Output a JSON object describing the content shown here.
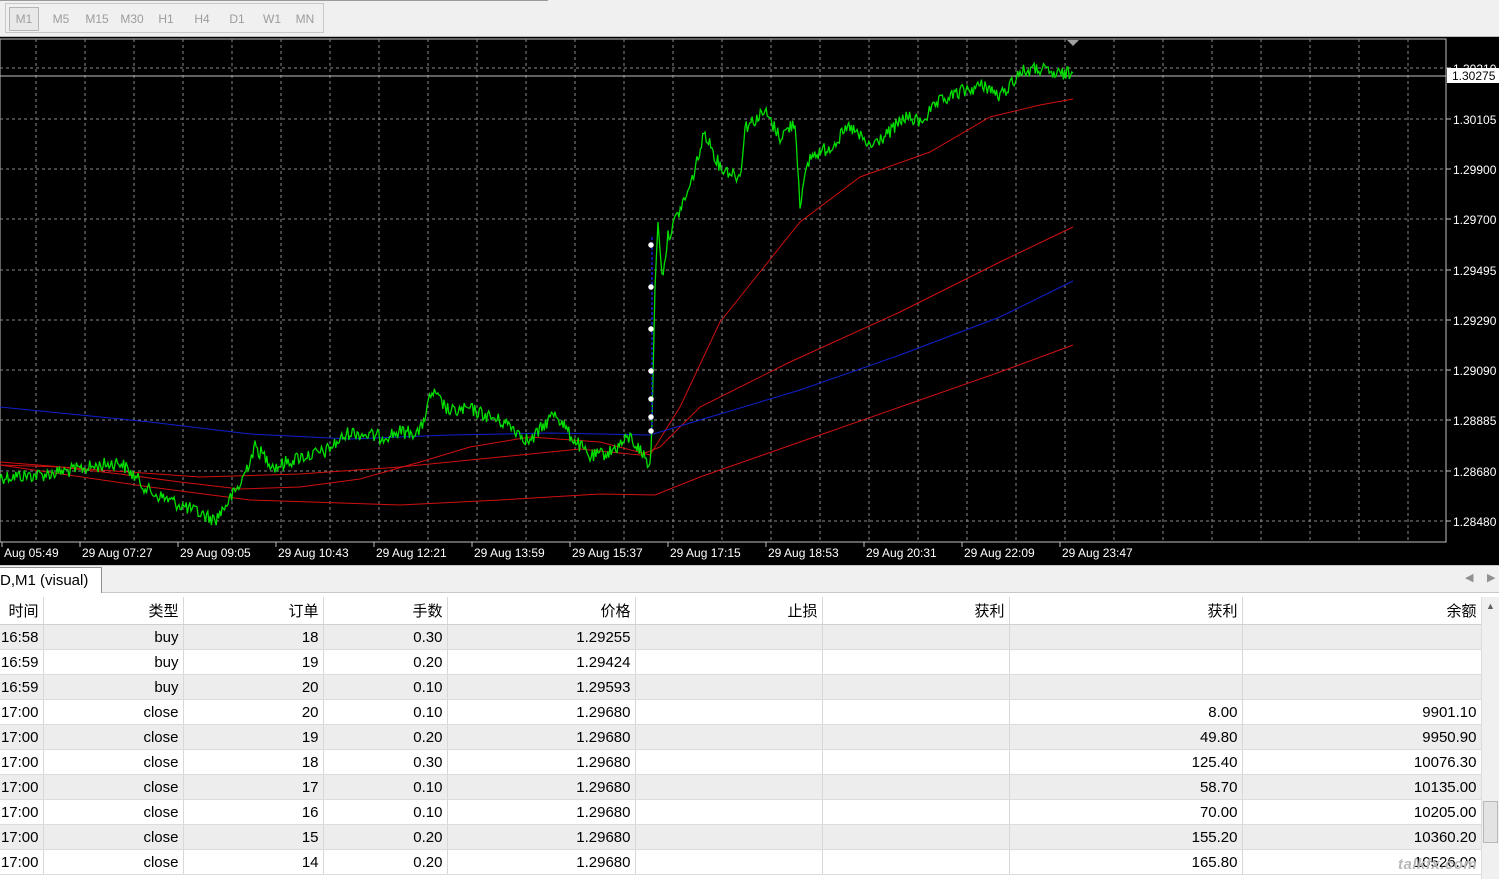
{
  "timeframes": [
    "M1",
    "M5",
    "M15",
    "M30",
    "H1",
    "H4",
    "D1",
    "W1",
    "MN"
  ],
  "active_timeframe": "M1",
  "chart": {
    "price_labels": [
      "1.30210",
      "1.30105",
      "1.29900",
      "1.29700",
      "1.29495",
      "1.29290",
      "1.29090",
      "1.28885",
      "1.28680",
      "1.28480"
    ],
    "current_price": "1.30275",
    "time_labels": [
      "Aug 05:49",
      "29 Aug 07:27",
      "29 Aug 09:05",
      "29 Aug 10:43",
      "29 Aug 12:21",
      "29 Aug 13:59",
      "29 Aug 15:37",
      "29 Aug 17:15",
      "29 Aug 18:53",
      "29 Aug 20:31",
      "29 Aug 22:09",
      "29 Aug 23:47"
    ],
    "colors": {
      "background": "#000000",
      "grid": "#8a8a8a",
      "price": "#00e000",
      "ma_red": "#d01010",
      "ma_blue": "#1020d0"
    }
  },
  "chart_tab": {
    "label": "D,M1 (visual)"
  },
  "table": {
    "headers": [
      "时间",
      "类型",
      "订单",
      "手数",
      "价格",
      "止损",
      "获利",
      "获利",
      "余额"
    ],
    "rows": [
      [
        "16:58",
        "buy",
        "18",
        "0.30",
        "1.29255",
        "",
        "",
        "",
        ""
      ],
      [
        "16:59",
        "buy",
        "19",
        "0.20",
        "1.29424",
        "",
        "",
        "",
        ""
      ],
      [
        "16:59",
        "buy",
        "20",
        "0.10",
        "1.29593",
        "",
        "",
        "",
        ""
      ],
      [
        "17:00",
        "close",
        "20",
        "0.10",
        "1.29680",
        "",
        "",
        "8.00",
        "9901.10"
      ],
      [
        "17:00",
        "close",
        "19",
        "0.20",
        "1.29680",
        "",
        "",
        "49.80",
        "9950.90"
      ],
      [
        "17:00",
        "close",
        "18",
        "0.30",
        "1.29680",
        "",
        "",
        "125.40",
        "10076.30"
      ],
      [
        "17:00",
        "close",
        "17",
        "0.10",
        "1.29680",
        "",
        "",
        "58.70",
        "10135.00"
      ],
      [
        "17:00",
        "close",
        "16",
        "0.10",
        "1.29680",
        "",
        "",
        "70.00",
        "10205.00"
      ],
      [
        "17:00",
        "close",
        "15",
        "0.20",
        "1.29680",
        "",
        "",
        "155.20",
        "10360.20"
      ],
      [
        "17:00",
        "close",
        "14",
        "0.20",
        "1.29680",
        "",
        "",
        "165.80",
        "10526.00"
      ]
    ]
  },
  "watermark": "talkfx.com"
}
